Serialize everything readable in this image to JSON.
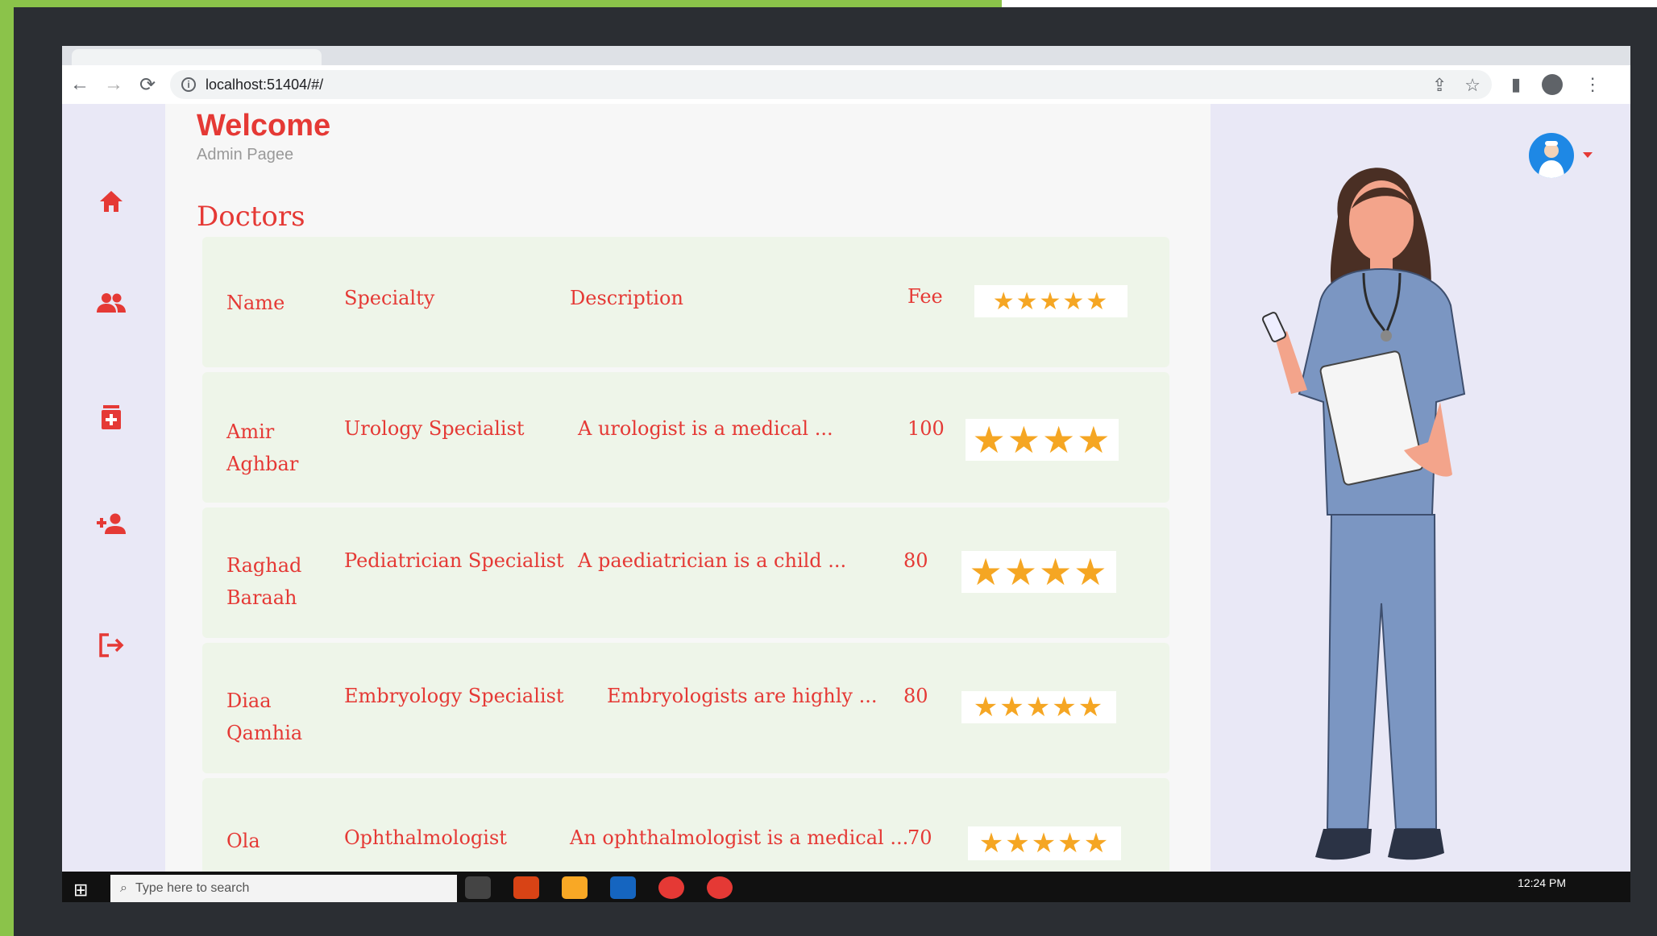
{
  "browser": {
    "url": "localhost:51404/#/",
    "icons": [
      "back-arrow-icon",
      "forward-arrow-icon",
      "reload-icon",
      "info-icon",
      "share-icon",
      "star-icon",
      "sidepanel-icon",
      "profile-icon",
      "more-icon"
    ]
  },
  "header": {
    "title": "Welcome",
    "subtitle": "Admin Pagee"
  },
  "sidebar": {
    "items": [
      {
        "icon": "home-icon"
      },
      {
        "icon": "people-icon"
      },
      {
        "icon": "medicine-icon"
      },
      {
        "icon": "add-person-icon"
      },
      {
        "icon": "logout-icon"
      }
    ],
    "color": "#e53935"
  },
  "section": {
    "title": "Doctors"
  },
  "table": {
    "headers": {
      "name": "Name",
      "specialty": "Specialty",
      "description": "Description",
      "fee": "Fee",
      "rating": "★★★★★"
    },
    "rows": [
      {
        "name": "Amir Aghbar",
        "specialty": "Urology Specialist",
        "description": "A urologist is a medical ...",
        "fee": "100",
        "rating": 4,
        "stars": "★★★★"
      },
      {
        "name": "Raghad Baraah",
        "specialty": "Pediatrician Specialist",
        "description": "A paediatrician is a child ...",
        "fee": "80",
        "rating": 4,
        "stars": "★★★★"
      },
      {
        "name": "Diaa Qamhia",
        "specialty": "Embryology Specialist",
        "description": "Embryologists are highly ...",
        "fee": "80",
        "rating": 5,
        "stars": "★★★★★"
      },
      {
        "name": "Ola",
        "specialty": "Ophthalmologist",
        "description": "An ophthalmologist is a medical ...",
        "fee": "70",
        "rating": 5,
        "stars": "★★★★★"
      }
    ]
  },
  "taskbar": {
    "search_placeholder": "Type here to search",
    "time": "12:24 PM"
  },
  "colors": {
    "accent": "#e53935",
    "star": "#f5a623",
    "row_bg": "#eef5e9",
    "page_bg": "#e9e8f6"
  }
}
